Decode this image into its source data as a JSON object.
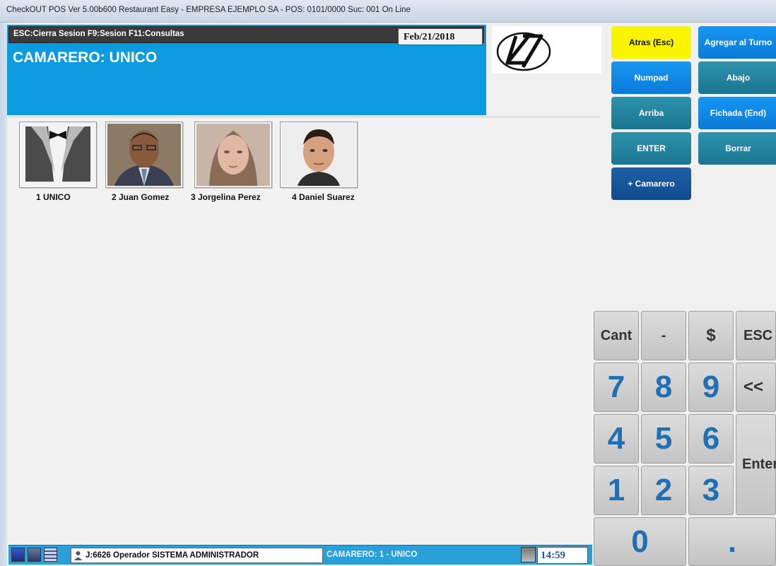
{
  "window": {
    "title": "CheckOUT POS Ver 5.00b600 Restaurant Easy - EMPRESA EJEMPLO SA - POS: 0101/0000 Suc: 001  On Line"
  },
  "header": {
    "hotkeys": "ESC:Cierra Sesion F9:Sesion F11:Consultas",
    "date": "Feb/21/2018",
    "waiter_title": "CAMARERO: UNICO",
    "logo": "L7"
  },
  "waiters": [
    {
      "label": "1 UNICO",
      "icon": "tuxedo-icon"
    },
    {
      "label": "2 Juan Gomez",
      "icon": "person-photo"
    },
    {
      "label": "3 Jorgelina Perez",
      "icon": "person-photo"
    },
    {
      "label": "4 Daniel Suarez",
      "icon": "person-photo"
    }
  ],
  "functions": {
    "back": "Atras (Esc)",
    "add_to_shift": "Agregar al Turno",
    "numpad": "Numpad",
    "down": "Abajo",
    "up": "Arriba",
    "clock_card": "Fichada (End)",
    "enter": "ENTER",
    "delete": "Borrar",
    "add_waiter": "+ Camarero"
  },
  "keypad": {
    "cant": "Cant",
    "minus": "-",
    "dollar": "$",
    "esc": "ESC",
    "seven": "7",
    "eight": "8",
    "nine": "9",
    "backspace": "<<",
    "four": "4",
    "five": "5",
    "six": "6",
    "enter": "Enter",
    "one": "1",
    "two": "2",
    "three": "3",
    "zero": "0",
    "dot": "."
  },
  "status": {
    "operator": "J:6626 Operador  SISTEMA ADMINISTRADOR",
    "waiter": "CAMARERO: 1 - UNICO",
    "time": "14:59"
  },
  "colors": {
    "header_blue": "#0d9be0",
    "button_teal": "#1b7590",
    "button_blue": "#0b7ad8",
    "button_navy": "#104a8c",
    "button_yellow": "#f9f400"
  }
}
